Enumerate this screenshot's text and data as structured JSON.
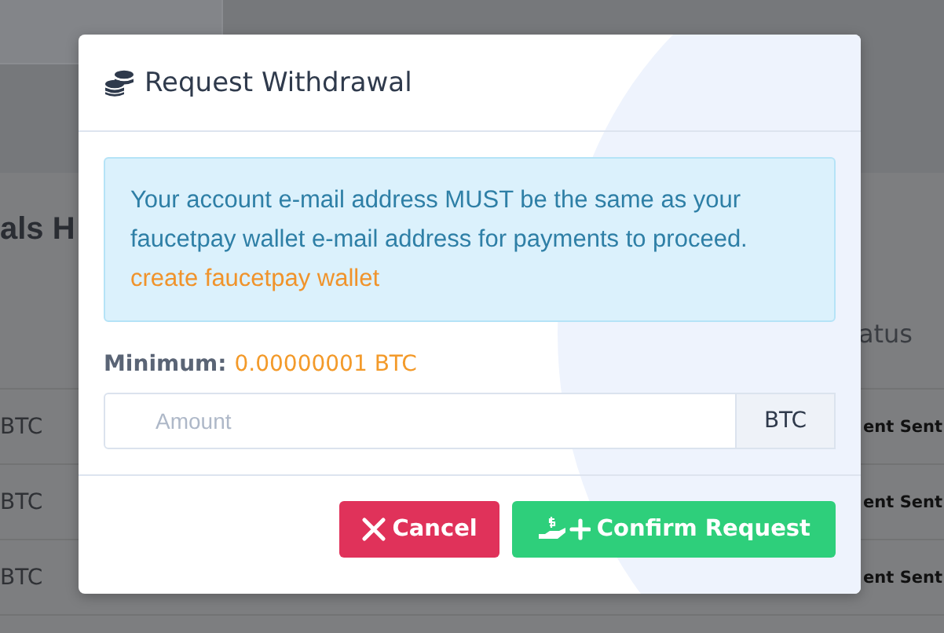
{
  "background_page": {
    "heading": "als H",
    "table": {
      "header": "atus",
      "rows": [
        {
          "column_1": "BTC",
          "column_2": "ent Sent"
        },
        {
          "column_1": "BTC",
          "column_2": "ent Sent"
        },
        {
          "column_1": "BTC",
          "column_2": "ent Sent"
        }
      ]
    }
  },
  "modal": {
    "title": "Request Withdrawal",
    "notice": {
      "text": "Your account e-mail address MUST be the same as your faucetpay wallet e-mail address for payments to proceed.",
      "link": "create faucetpay wallet"
    },
    "minimum": {
      "label": "Minimum:",
      "value": "0.00000001 BTC"
    },
    "amount_field": {
      "placeholder": "Amount",
      "addon": "BTC"
    },
    "buttons": [
      {
        "kind": "cancel",
        "label": "Cancel"
      },
      {
        "kind": "confirm",
        "label": "Confirm Request"
      }
    ]
  }
}
